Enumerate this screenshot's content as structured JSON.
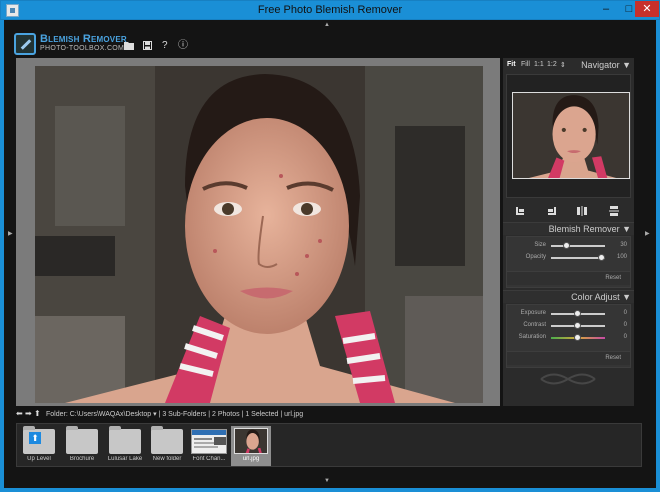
{
  "window": {
    "title": "Free Photo Blemish Remover",
    "min": "–",
    "max": "□",
    "close": "✕"
  },
  "header": {
    "logo_title": "Blemish Remover",
    "logo_subtitle": "PHOTO-TOOLBOX.COM",
    "help": "?",
    "info": "ⓘ"
  },
  "navigator": {
    "zoom_fit": "Fit",
    "zoom_fill": "Fill",
    "zoom_1_1": "1:1",
    "zoom_1_2": "1:2",
    "title": "Navigator ▼"
  },
  "blemish": {
    "title": "Blemish Remover ▼",
    "size_label": "Size",
    "size_value": "30",
    "opacity_label": "Opacity",
    "opacity_value": "100",
    "reset": "Reset"
  },
  "color": {
    "title": "Color Adjust ▼",
    "exposure_label": "Exposure",
    "exposure_value": "0",
    "contrast_label": "Contrast",
    "contrast_value": "0",
    "saturation_label": "Saturation",
    "saturation_value": "0",
    "reset": "Reset"
  },
  "pathbar": {
    "text": "Folder:  C:\\Users\\WAQAx\\Desktop ▾ | 3 Sub-Folders | 2 Photos | 1 Selected | url.jpg"
  },
  "browser": {
    "items": [
      {
        "label": "Up Level"
      },
      {
        "label": "Brochure"
      },
      {
        "label": "Lulusar Lake"
      },
      {
        "label": "New folder"
      },
      {
        "label": "Font Chan..."
      },
      {
        "label": "url.jpg"
      }
    ]
  },
  "colors": {
    "accent": "#1a8fd6",
    "close": "#c7302b",
    "logo": "#4aa3e0"
  }
}
